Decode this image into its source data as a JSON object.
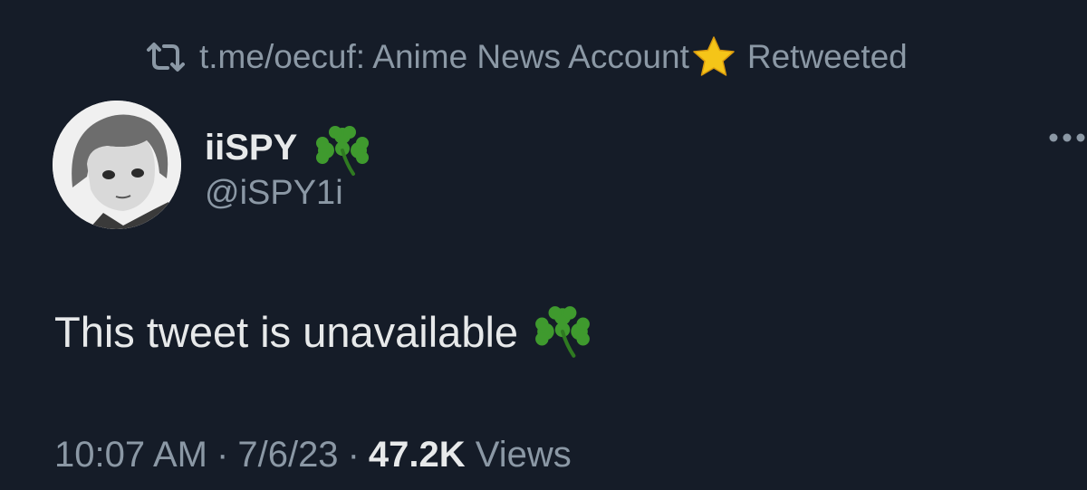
{
  "retweet": {
    "icon": "retweet-icon",
    "account": "t.me/oecuf: Anime News Account",
    "emoji": "star-icon",
    "suffix": "Retweeted"
  },
  "author": {
    "display_name": "iiSPY",
    "name_emoji": "shamrock-icon",
    "handle": "@iSPY1i",
    "avatar": "anime-boy-avatar"
  },
  "tweet": {
    "text": "This tweet is unavailable",
    "emoji": "shamrock-icon"
  },
  "meta": {
    "time": "10:07 AM",
    "separator": "·",
    "date": "7/6/23",
    "views_count": "47.2K",
    "views_label": "Views"
  },
  "colors": {
    "background": "#151c28",
    "primary_text": "#e7e9ea",
    "secondary_text": "#8b98a5",
    "shamrock": "#3f9a2e",
    "star": "#f5c518"
  }
}
